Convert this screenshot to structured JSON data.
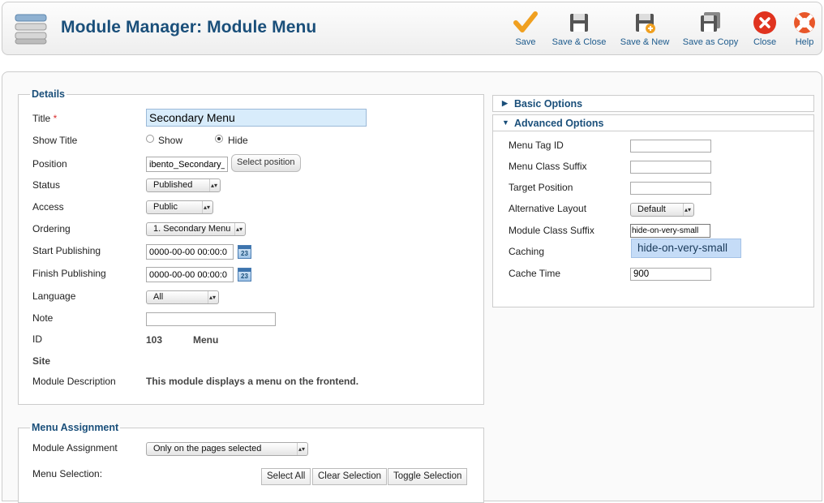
{
  "header": {
    "title": "Module Manager: Module Menu"
  },
  "toolbar": [
    {
      "label": "Save",
      "icon": "checkmark-icon"
    },
    {
      "label": "Save & Close",
      "icon": "floppy-icon"
    },
    {
      "label": "Save & New",
      "icon": "floppy-plus-icon"
    },
    {
      "label": "Save as Copy",
      "icon": "floppy-copy-icon"
    },
    {
      "label": "Close",
      "icon": "close-icon"
    },
    {
      "label": "Help",
      "icon": "lifebuoy-icon"
    }
  ],
  "details": {
    "legend": "Details",
    "title_label": "Title",
    "title_required": "*",
    "title_value": "Secondary Menu",
    "show_title_label": "Show Title",
    "show_option": "Show",
    "hide_option": "Hide",
    "show_title_selected": "Hide",
    "position_label": "Position",
    "position_value": "ibento_Secondary_M",
    "select_position": "Select position",
    "status_label": "Status",
    "status_value": "Published",
    "access_label": "Access",
    "access_value": "Public",
    "ordering_label": "Ordering",
    "ordering_value": "1. Secondary Menu",
    "start_label": "Start Publishing",
    "start_value": "0000-00-00 00:00:0",
    "finish_label": "Finish Publishing",
    "finish_value": "0000-00-00 00:00:0",
    "calendar_day": "23",
    "language_label": "Language",
    "language_value": "All",
    "note_label": "Note",
    "note_value": "",
    "id_label": "ID",
    "id_value": "103",
    "id_type": "Menu",
    "site_label": "Site",
    "desc_label": "Module Description",
    "desc_value": "This module displays a menu on the frontend."
  },
  "assignment": {
    "legend": "Menu Assignment",
    "module_assignment_label": "Module Assignment",
    "module_assignment_value": "Only on the pages selected",
    "menu_selection_label": "Menu Selection:",
    "select_all": "Select All",
    "clear_selection": "Clear Selection",
    "toggle_selection": "Toggle Selection"
  },
  "basic_options": {
    "title": "Basic Options"
  },
  "advanced_options": {
    "title": "Advanced Options",
    "menu_tag_id_label": "Menu Tag ID",
    "menu_tag_id_value": "",
    "menu_class_suffix_label": "Menu Class Suffix",
    "menu_class_suffix_value": "",
    "target_position_label": "Target Position",
    "target_position_value": "",
    "alt_layout_label": "Alternative Layout",
    "alt_layout_value": "Default",
    "module_class_suffix_label": "Module Class Suffix",
    "module_class_suffix_value": "hide-on-very-small",
    "autocomplete_suggestion": "hide-on-very-small",
    "caching_label": "Caching",
    "cache_time_label": "Cache Time",
    "cache_time_value": "900"
  },
  "colors": {
    "heading": "#1a4f7a",
    "title_input_bg": "#d8ecfb",
    "suggestion_bg": "#c5dcf7",
    "required": "#d93030"
  }
}
